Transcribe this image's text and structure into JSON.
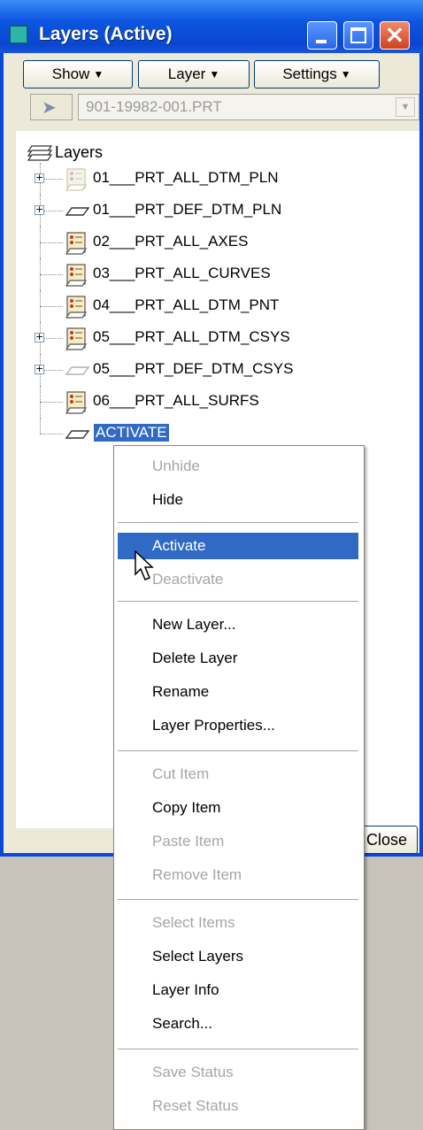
{
  "window": {
    "title": "Layers (Active)"
  },
  "toolbar": {
    "show_label": "Show",
    "layer_label": "Layer",
    "settings_label": "Settings",
    "model_selector": "901-19982-001.PRT"
  },
  "tree": {
    "root_label": "Layers",
    "rows": [
      {
        "label": "01___PRT_ALL_DTM_PLN",
        "expander": "+",
        "icon": "layer-list-icon-faded"
      },
      {
        "label": "01___PRT_DEF_DTM_PLN",
        "expander": "+",
        "icon": "plane-icon"
      },
      {
        "label": "02___PRT_ALL_AXES",
        "expander": "",
        "icon": "layer-list-icon"
      },
      {
        "label": "03___PRT_ALL_CURVES",
        "expander": "",
        "icon": "layer-list-icon"
      },
      {
        "label": "04___PRT_ALL_DTM_PNT",
        "expander": "",
        "icon": "layer-list-icon"
      },
      {
        "label": "05___PRT_ALL_DTM_CSYS",
        "expander": "+",
        "icon": "layer-list-icon"
      },
      {
        "label": "05___PRT_DEF_DTM_CSYS",
        "expander": "+",
        "icon": "plane-icon-faded"
      },
      {
        "label": "06___PRT_ALL_SURFS",
        "expander": "",
        "icon": "layer-list-icon"
      },
      {
        "label": "ACTIVATE",
        "expander": "",
        "icon": "plane-icon",
        "editing": true
      }
    ]
  },
  "footer": {
    "close_label": "Close",
    "ghost_text": "..."
  },
  "context_menu": {
    "items": [
      {
        "label": "Unhide",
        "state": "disabled"
      },
      {
        "label": "Hide",
        "state": "enabled"
      },
      {
        "label": "Activate",
        "state": "highlight"
      },
      {
        "label": "Deactivate",
        "state": "disabled"
      },
      {
        "label": "New Layer...",
        "state": "enabled"
      },
      {
        "label": "Delete Layer",
        "state": "enabled"
      },
      {
        "label": "Rename",
        "state": "enabled"
      },
      {
        "label": "Layer Properties...",
        "state": "enabled"
      },
      {
        "label": "Cut Item",
        "state": "disabled"
      },
      {
        "label": "Copy Item",
        "state": "enabled"
      },
      {
        "label": "Paste Item",
        "state": "disabled"
      },
      {
        "label": "Remove Item",
        "state": "disabled"
      },
      {
        "label": "Select Items",
        "state": "disabled"
      },
      {
        "label": "Select Layers",
        "state": "enabled"
      },
      {
        "label": "Layer Info",
        "state": "enabled"
      },
      {
        "label": "Search...",
        "state": "enabled"
      },
      {
        "label": "Save Status",
        "state": "disabled"
      },
      {
        "label": "Reset Status",
        "state": "disabled"
      }
    ]
  },
  "colors": {
    "title_bar": "#0a48d6",
    "highlight": "#316ac5",
    "disabled_text": "#a6a6a6"
  }
}
